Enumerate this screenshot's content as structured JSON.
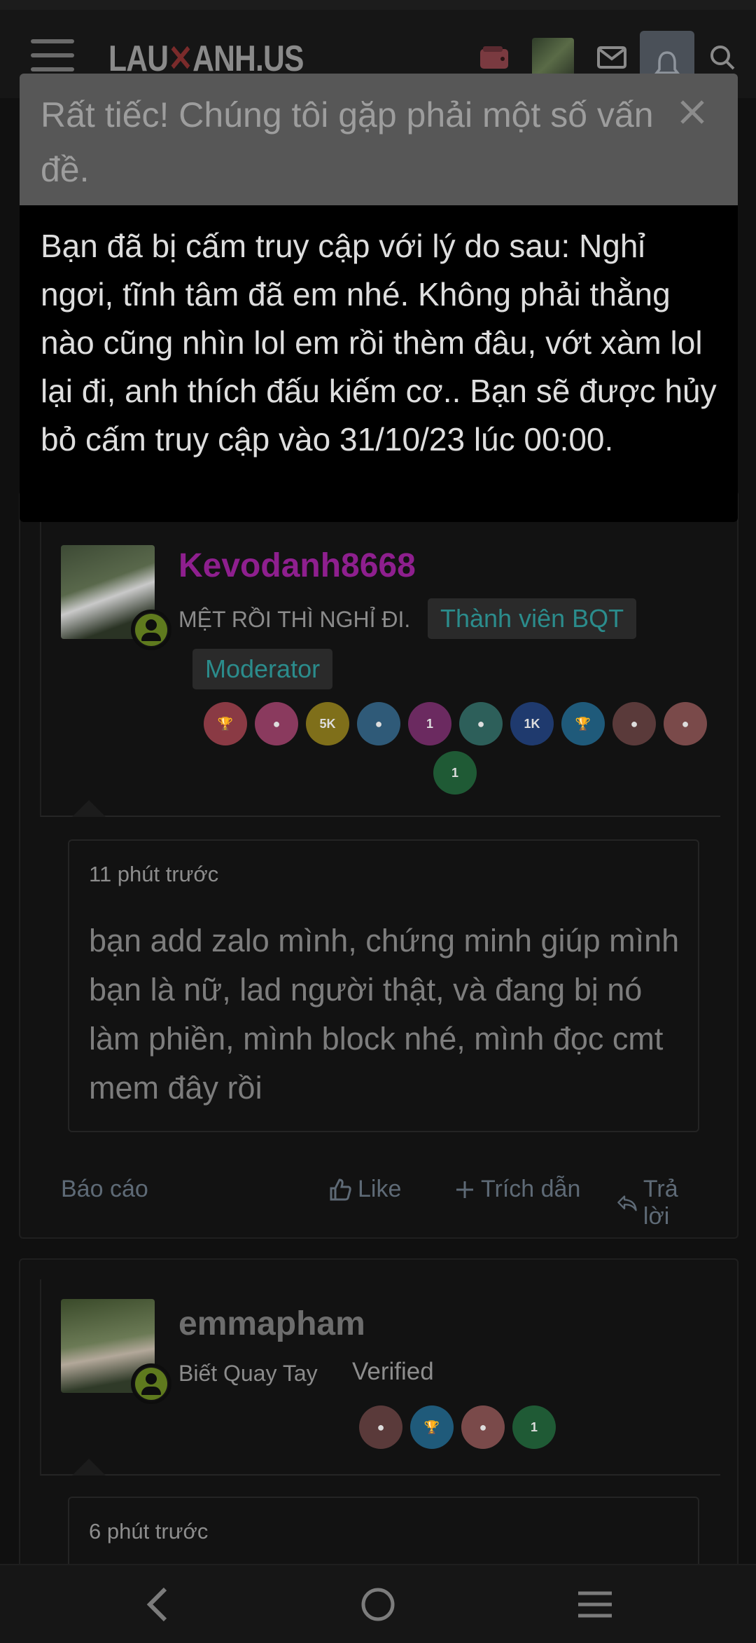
{
  "navbar": {
    "logo_left": "LAU",
    "logo_mid": "✕",
    "logo_right": "ANH.US"
  },
  "error_modal": {
    "title": "Rất tiếc! Chúng tôi gặp phải một số vấn đề.",
    "message": "Bạn đã bị cấm truy cập với lý do sau: Nghỉ ngơi, tĩnh tâm đã em nhé. Không phải thằng nào cũng nhìn lol em rồi thèm đâu, vớt xàm lol lại đi, anh thích đấu kiếm cơ.. Bạn sẽ được hủy bỏ cấm truy cập vào 31/10/23 lúc 00:00."
  },
  "posts": [
    {
      "username": "Kevodanh8668",
      "username_color": "#8e1f8e",
      "user_title": "MỆT RỒI THÌ NGHỈ ĐI.",
      "badges": [
        "Thành viên BQT",
        "Moderator"
      ],
      "trophies": [
        {
          "icon": "trophy-cup-icon",
          "color": "#8a3a44"
        },
        {
          "icon": "person-icon",
          "color": "#8a3a5e"
        },
        {
          "icon": "5k-badge-icon",
          "color": "#7f6f1a",
          "label": "5K"
        },
        {
          "icon": "person-icon",
          "color": "#2f5a78"
        },
        {
          "icon": "star-burst-icon",
          "color": "#6b2a60",
          "label": "1"
        },
        {
          "icon": "person-icon",
          "color": "#2d5f5a"
        },
        {
          "icon": "1k-badge-icon",
          "color": "#1f3a6e",
          "label": "1K"
        },
        {
          "icon": "trophy-cup-icon",
          "color": "#1f5a7a"
        },
        {
          "icon": "person-icon",
          "color": "#5a3a3a"
        },
        {
          "icon": "person-icon",
          "color": "#7a4a4a"
        },
        {
          "icon": "one-badge-icon",
          "color": "#1f5a35",
          "label": "1"
        }
      ],
      "time": "11 phút trước",
      "content": "bạn add zalo mình, chứng minh giúp mình bạn là nữ, lad người thật, và đang bị nó làm phiền, mình block nhé, mình đọc cmt mem đây rồi",
      "actions": {
        "report": "Báo cáo",
        "like": "Like",
        "quote": "Trích dẫn",
        "reply": "Trả lời"
      }
    },
    {
      "username": "emmapham",
      "username_color": "#6d6d6d",
      "user_title": "Biết Quay Tay",
      "badges": [
        "Verified"
      ],
      "trophies": [
        {
          "icon": "person-icon",
          "color": "#5a3a3a"
        },
        {
          "icon": "trophy-cup-icon",
          "color": "#1f5a7a"
        },
        {
          "icon": "person-icon",
          "color": "#7a4a4a"
        },
        {
          "icon": "one-badge-icon",
          "color": "#1f5a35",
          "label": "1"
        }
      ],
      "time": "6 phút trước"
    }
  ]
}
